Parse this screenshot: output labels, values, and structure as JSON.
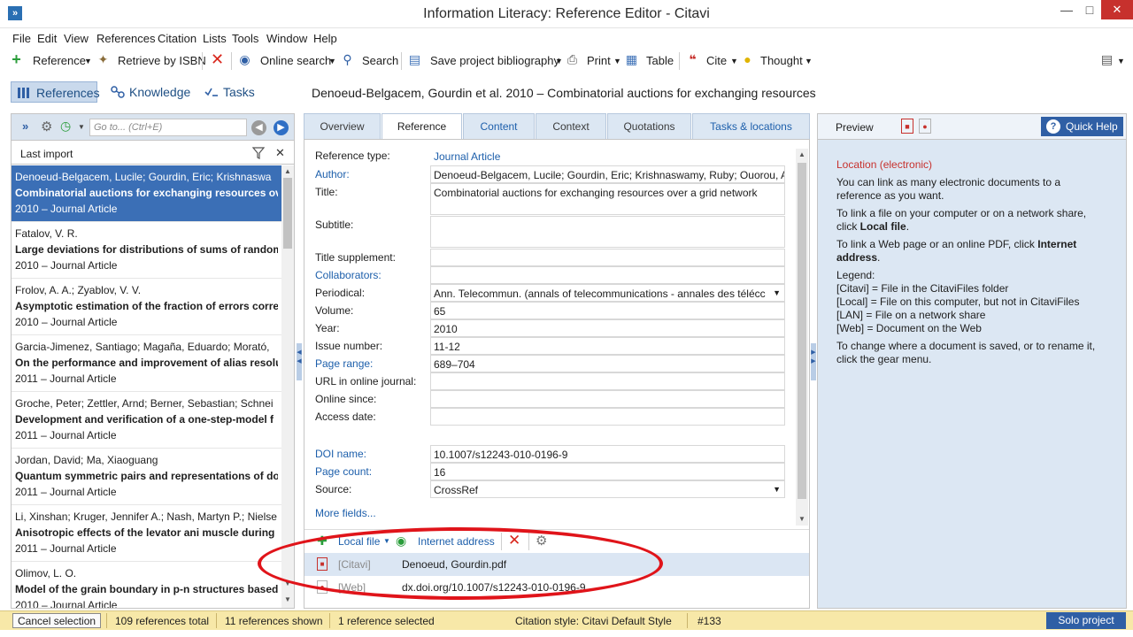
{
  "window": {
    "title": "Information Literacy: Reference Editor - Citavi"
  },
  "menu": [
    "File",
    "Edit",
    "View",
    "References",
    "Citation",
    "Lists",
    "Tools",
    "Window",
    "Help"
  ],
  "toolbar": {
    "reference": "Reference",
    "retrieve_isbn": "Retrieve by ISBN",
    "online_search": "Online search",
    "search": "Search",
    "save_bibliography": "Save project bibliography",
    "print": "Print",
    "table": "Table",
    "cite": "Cite",
    "thought": "Thought"
  },
  "nav": {
    "references": "References",
    "knowledge": "Knowledge",
    "tasks": "Tasks",
    "heading": "Denoeud-Belgacem, Gourdin et al. 2010 – Combinatorial auctions for exchanging resources"
  },
  "left": {
    "goto_placeholder": "Go to... (Ctrl+E)",
    "filter_label": "Last import",
    "items": [
      {
        "authors": "Denoeud-Belgacem, Lucile; Gourdin, Eric; Krishnaswa",
        "title": "Combinatorial auctions for exchanging resources ove",
        "meta": "2010 – Journal Article"
      },
      {
        "authors": "Fatalov, V. R.",
        "title": "Large deviations for distributions of sums of random",
        "meta": "2010 – Journal Article"
      },
      {
        "authors": "Frolov, A. A.; Zyablov, V. V.",
        "title": "Asymptotic estimation of the fraction of errors corre",
        "meta": "2010 – Journal Article"
      },
      {
        "authors": "Garcia-Jimenez, Santiago; Magaña, Eduardo; Morató,",
        "title": "On the performance and improvement of alias resolu",
        "meta": "2011 – Journal Article"
      },
      {
        "authors": "Groche, Peter; Zettler, Arnd; Berner, Sebastian; Schnei",
        "title": "Development and verification of a one-step-model f",
        "meta": "2011 – Journal Article"
      },
      {
        "authors": "Jordan, David; Ma, Xiaoguang",
        "title": "Quantum symmetric pairs and representations of dou",
        "meta": "2011 – Journal Article"
      },
      {
        "authors": "Li, Xinshan; Kruger, Jennifer A.; Nash, Martyn P.; Nielse",
        "title": "Anisotropic effects of the levator ani muscle during c",
        "meta": "2011 – Journal Article"
      },
      {
        "authors": "Olimov, L. O.",
        "title": "Model of the grain boundary in p-n structures based",
        "meta": "2010 – Journal Article"
      }
    ]
  },
  "tabs": [
    "Overview",
    "Reference",
    "Content",
    "Context",
    "Quotations",
    "Tasks & locations"
  ],
  "form": {
    "reference_type_label": "Reference type:",
    "reference_type": "Journal Article",
    "author_label": "Author:",
    "author": "Denoeud-Belgacem, Lucile; Gourdin, Eric; Krishnaswamy, Ruby; Ouorou, Ad",
    "title_label": "Title:",
    "title": "Combinatorial auctions for exchanging resources over a grid network",
    "subtitle_label": "Subtitle:",
    "title_supplement_label": "Title supplement:",
    "collaborators_label": "Collaborators:",
    "periodical_label": "Periodical:",
    "periodical": "Ann. Telecommun. (annals of telecommunications - annales des télécc",
    "volume_label": "Volume:",
    "volume": "65",
    "year_label": "Year:",
    "year": "2010",
    "issue_label": "Issue number:",
    "issue": "11-12",
    "page_range_label": "Page range:",
    "page_range": "689–704",
    "url_label": "URL in online journal:",
    "online_since_label": "Online since:",
    "access_date_label": "Access date:",
    "doi_label": "DOI name:",
    "doi": "10.1007/s12243-010-0196-9",
    "page_count_label": "Page count:",
    "page_count": "16",
    "source_label": "Source:",
    "source": "CrossRef",
    "more_fields": "More fields..."
  },
  "attachments": {
    "local_file": "Local file",
    "internet_address": "Internet address",
    "rows": [
      {
        "tag": "[Citavi]",
        "name": "Denoeud, Gourdin.pdf"
      },
      {
        "tag": "[Web]",
        "name": "dx.doi.org/10.1007/s12243-010-0196-9"
      }
    ]
  },
  "right": {
    "preview_tab": "Preview",
    "quick_help": "Quick Help",
    "heading": "Location (electronic)",
    "p1": "You can link as many electronic documents to a reference as you want.",
    "p2a": "To link a file on your computer or on a network share, click ",
    "p2b": "Local file",
    "p3a": "To link a Web page or an online PDF, click ",
    "p3b": "Internet address",
    "legend_title": "Legend:",
    "legend": [
      "[Citavi] = File in the CitaviFiles folder",
      "[Local] = File on this computer, but not in CitaviFiles",
      "[LAN] = File on a network share",
      "[Web] = Document on the Web"
    ],
    "p4": "To change where a document is saved, or to rename it, click the gear menu."
  },
  "status": {
    "cancel_selection": "Cancel selection",
    "total": "109 references total",
    "shown": "11 references shown",
    "selected": "1 reference selected",
    "citation_style": "Citation style: Citavi Default Style",
    "number": "#133",
    "solo": "Solo project"
  },
  "colors": {
    "accent": "#2f5fa5",
    "selection": "#3b6fb6",
    "statusbar": "#f7e8a8",
    "annotation": "#e0141a"
  }
}
